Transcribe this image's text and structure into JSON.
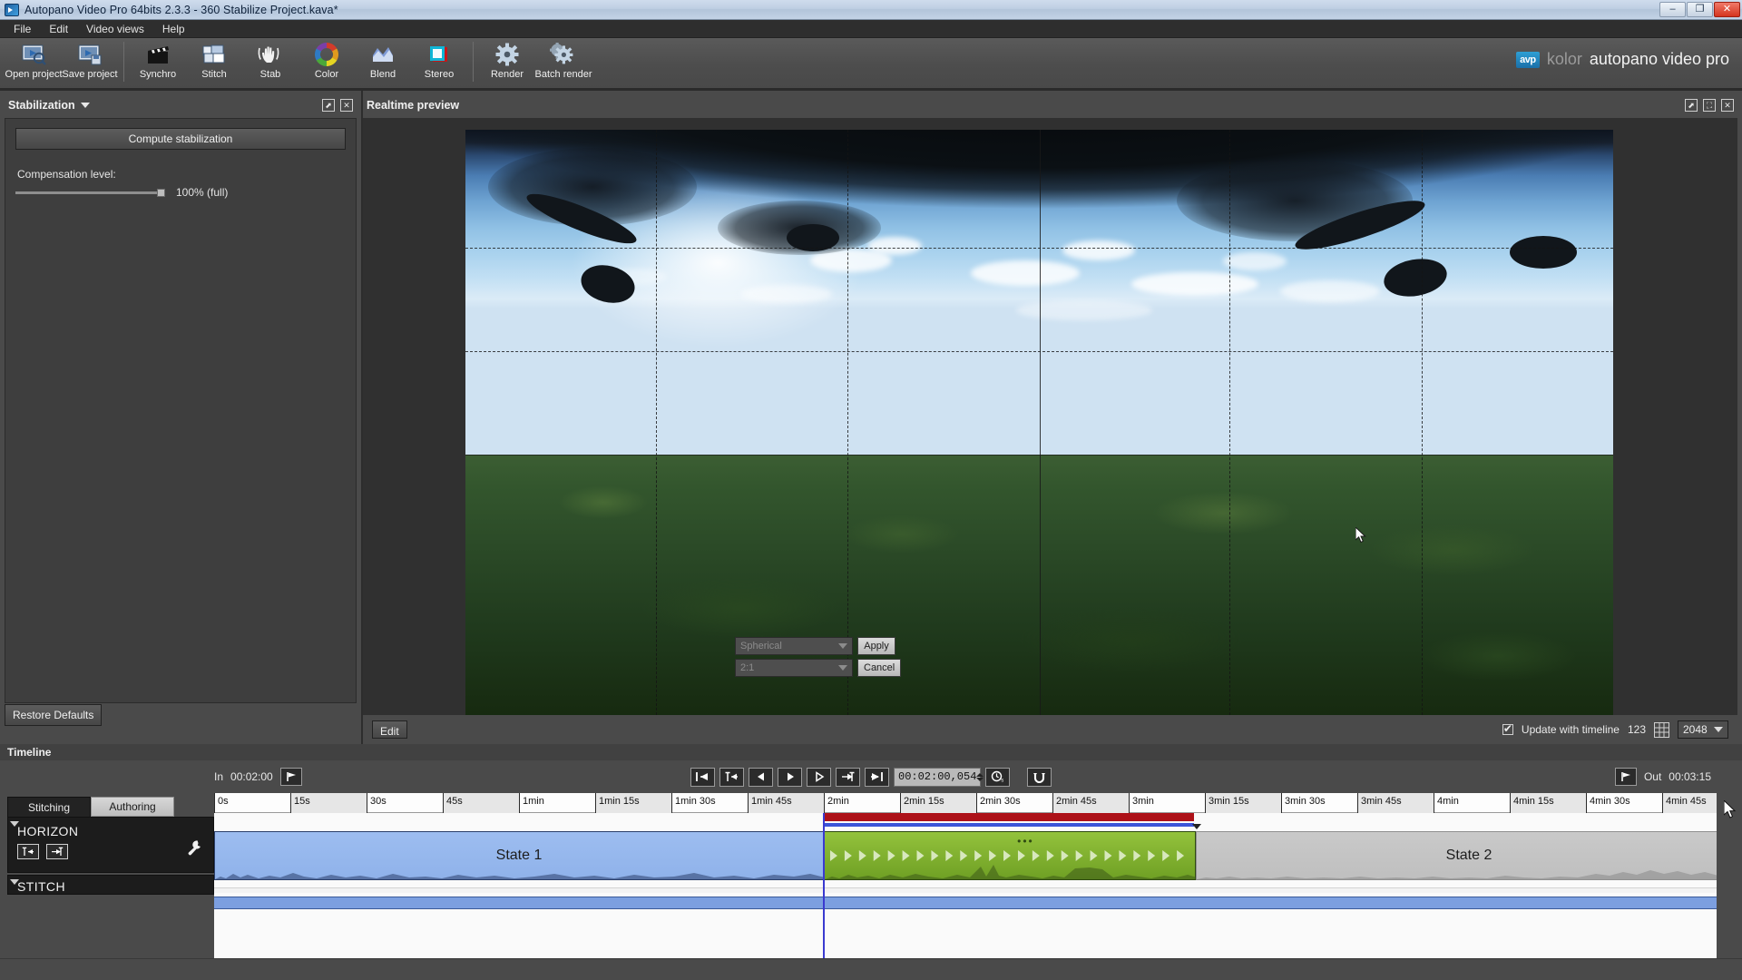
{
  "window": {
    "title": "Autopano Video Pro 64bits 2.3.3 - 360 Stabilize Project.kava*",
    "minimize": "–",
    "maximize": "❐",
    "close": "✕"
  },
  "menu": [
    "File",
    "Edit",
    "Video views",
    "Help"
  ],
  "toolbar": [
    {
      "label": "Open project",
      "icon": "open-project-icon"
    },
    {
      "label": "Save project",
      "icon": "save-project-icon"
    },
    {
      "label": "Synchro",
      "icon": "clapperboard-icon"
    },
    {
      "label": "Stitch",
      "icon": "stitch-icon"
    },
    {
      "label": "Stab",
      "icon": "hand-icon"
    },
    {
      "label": "Color",
      "icon": "color-wheel-icon"
    },
    {
      "label": "Blend",
      "icon": "blend-icon"
    },
    {
      "label": "Stereo",
      "icon": "stereo-icon"
    },
    {
      "label": "Render",
      "icon": "gear-icon"
    },
    {
      "label": "Batch render",
      "icon": "gears-icon"
    }
  ],
  "brand": {
    "badge": "avp",
    "prefix": "kolor",
    "name": "autopano video pro"
  },
  "stabilization": {
    "title": "Stabilization",
    "compute_button": "Compute stabilization",
    "compensation_label": "Compensation level:",
    "compensation_value": "100% (full)",
    "compensation_percent": 100,
    "restore_button": "Restore Defaults"
  },
  "preview": {
    "title": "Realtime preview",
    "projection": "Spherical",
    "aspect": "2:1",
    "apply": "Apply",
    "cancel": "Cancel",
    "edit": "Edit",
    "update_with_timeline": "Update with timeline",
    "update_checked": true,
    "frame_number": "123",
    "resolution": "2048"
  },
  "timeline": {
    "title": "Timeline",
    "in_label": "In",
    "in_value": "00:02:00",
    "out_label": "Out",
    "out_value": "00:03:15",
    "current_time": "00:02:00,054",
    "transport": [
      "go-to-start-button",
      "previous-marker-button",
      "step-backward-button",
      "play-button",
      "step-forward-button",
      "next-marker-button",
      "go-to-end-button"
    ],
    "tabs": [
      {
        "label": "Stitching",
        "active": true
      },
      {
        "label": "Authoring",
        "active": false
      }
    ],
    "tracks": [
      {
        "name": "HORIZON"
      },
      {
        "name": "STITCH"
      }
    ],
    "ruler_ticks": [
      "0s",
      "15s",
      "30s",
      "45s",
      "1min",
      "1min 15s",
      "1min 30s",
      "1min 45s",
      "2min",
      "2min 15s",
      "2min 30s",
      "2min 45s",
      "3min",
      "3min 15s",
      "3min 30s",
      "3min 45s",
      "4min",
      "4min 15s",
      "4min 30s",
      "4min 45s"
    ],
    "clips": [
      {
        "label": "State 1",
        "kind": "blue"
      },
      {
        "label": "",
        "kind": "green"
      },
      {
        "label": "State 2",
        "kind": "grey"
      }
    ]
  },
  "colors": {
    "accent_blue": "#3b53d8",
    "range_red": "#ad1118",
    "clip_green": "#6fa024",
    "clip_blue": "#9dbdf0",
    "panel_bg": "#4a4a4a"
  }
}
